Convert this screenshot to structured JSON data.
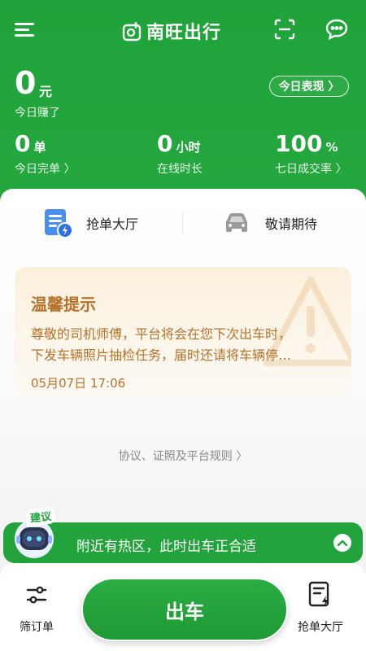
{
  "header": {
    "logo_text": "南旺出行",
    "menu_icon": "menu-icon",
    "scan_icon": "scan-icon",
    "message_icon": "message-icon"
  },
  "earnings": {
    "value": "0",
    "unit": "元",
    "label": "今日赚了",
    "today_button": "今日表现 〉"
  },
  "stats": [
    {
      "value": "0",
      "unit": "单",
      "label": "今日完单 〉"
    },
    {
      "value": "0",
      "unit": "小时",
      "label": "在线时长"
    },
    {
      "value": "100",
      "unit": "%",
      "label": "七日成交率 〉"
    }
  ],
  "quick_actions": [
    {
      "label": "抢单大厅",
      "icon": "order-document-icon"
    },
    {
      "label": "敬请期待",
      "icon": "car-icon"
    }
  ],
  "notice": {
    "title": "温馨提示",
    "line1": "尊敬的司机师傅，平台将会在您下次出车时，",
    "line2": "下发车辆照片抽检任务，届时还请将车辆停…",
    "date": "05月07日 17:06"
  },
  "rules_link": "协议、证照及平台规则 〉",
  "suggestion": {
    "badge": "建议",
    "text": "附近有热区，此时出车正合适"
  },
  "bottom_nav": {
    "filter_label": "筛订单",
    "go_label": "出车",
    "hall_label": "抢单大厅"
  },
  "colors": {
    "brand_green": "#22a33b",
    "notice_text": "#b6722a",
    "notice_bg": "#fbf0dc"
  }
}
